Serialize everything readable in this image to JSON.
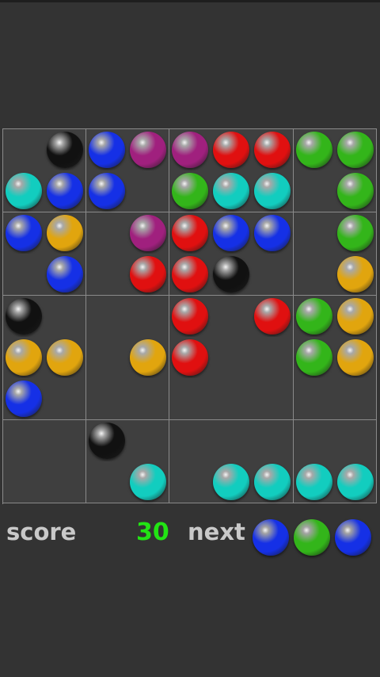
{
  "footer": {
    "score_label": "score",
    "score_value": "30",
    "next_label": "next"
  },
  "board": {
    "rows": 9,
    "cols": 9,
    "cells": [
      [
        "",
        "black",
        "blue",
        "purple",
        "purple",
        "red",
        "red",
        "green",
        "green"
      ],
      [
        "cyan",
        "blue",
        "blue",
        "",
        "green",
        "cyan",
        "cyan",
        "",
        "green"
      ],
      [
        "blue",
        "yellow",
        "",
        "purple",
        "red",
        "blue",
        "blue",
        "",
        "green"
      ],
      [
        "",
        "blue",
        "",
        "red",
        "red",
        "black",
        "",
        "",
        "yellow"
      ],
      [
        "black",
        "",
        "",
        "",
        "red",
        "",
        "red",
        "green",
        "yellow"
      ],
      [
        "yellow",
        "yellow",
        "",
        "yellow",
        "red",
        "",
        "",
        "green",
        "yellow"
      ],
      [
        "blue",
        "",
        "",
        "",
        "",
        "",
        "",
        "",
        ""
      ],
      [
        "",
        "",
        "black",
        "",
        "",
        "",
        "",
        "",
        ""
      ],
      [
        "",
        "",
        "",
        "cyan",
        "",
        "cyan",
        "cyan",
        "cyan",
        "cyan"
      ]
    ]
  },
  "next_balls": [
    "blue",
    "green",
    "blue"
  ],
  "colors": {
    "background": "#333333",
    "grid_line": "#8a8a8a",
    "score_value": "#22e414",
    "label": "#c9c9c9",
    "balls": {
      "black": "#111111",
      "blue": "#1530e6",
      "purple": "#a0207e",
      "red": "#e01010",
      "green": "#33b51a",
      "cyan": "#12cdbf",
      "yellow": "#e1a50e"
    }
  }
}
